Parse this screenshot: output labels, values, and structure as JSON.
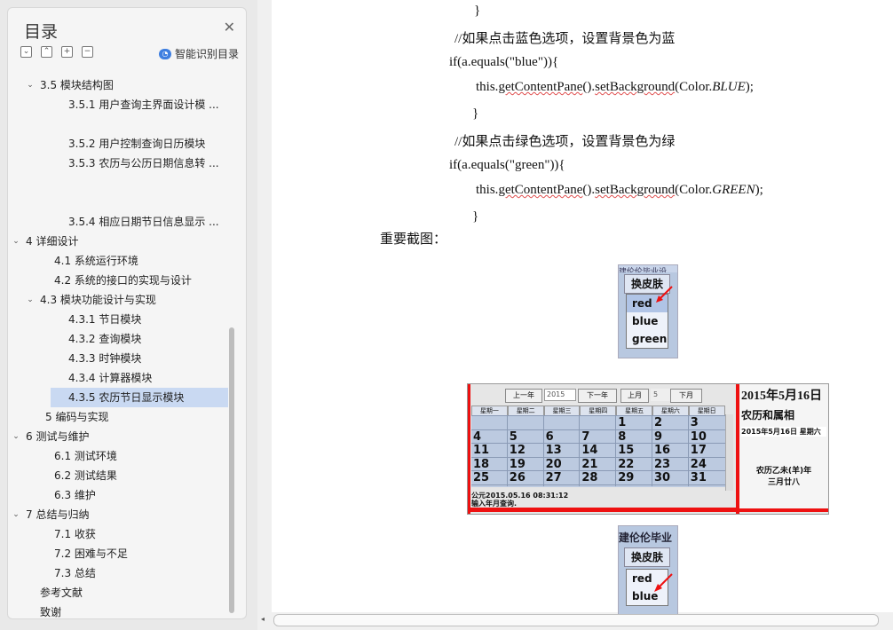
{
  "nav": {
    "title": "目录",
    "smart_label": "智能识别目录",
    "items": [
      {
        "text": "3.5  模块结构图",
        "arrow": "⌄"
      },
      {
        "text": "3.5.1  用户查询主界面设计模 ...",
        "arrow": ""
      },
      {
        "text": "3.5.2  用户控制查询日历模块",
        "arrow": ""
      },
      {
        "text": "3.5.3 农历与公历日期信息转 ...",
        "arrow": ""
      },
      {
        "text": "3.5.4 相应日期节日信息显示 ...",
        "arrow": ""
      },
      {
        "text": "4  详细设计",
        "arrow": "⌄"
      },
      {
        "text": "4.1  系统运行环境",
        "arrow": ""
      },
      {
        "text": "4.2  系统的接口的实现与设计",
        "arrow": ""
      },
      {
        "text": "4.3 模块功能设计与实现",
        "arrow": "⌄"
      },
      {
        "text": "4.3.1  节日模块",
        "arrow": ""
      },
      {
        "text": "4.3.2  查询模块",
        "arrow": ""
      },
      {
        "text": "4.3.3  时钟模块",
        "arrow": ""
      },
      {
        "text": "4.3.4  计算器模块",
        "arrow": ""
      },
      {
        "text": "4.3.5  农历节日显示模块",
        "arrow": ""
      },
      {
        "text": "5  编码与实现",
        "arrow": ""
      },
      {
        "text": "6  测试与维护",
        "arrow": "⌄"
      },
      {
        "text": "6.1 测试环境",
        "arrow": ""
      },
      {
        "text": "6.2  测试结果",
        "arrow": ""
      },
      {
        "text": "6.3  维护",
        "arrow": ""
      },
      {
        "text": "7  总结与归纳",
        "arrow": "⌄"
      },
      {
        "text": "7.1  收获",
        "arrow": ""
      },
      {
        "text": "7.2  困难与不足",
        "arrow": ""
      },
      {
        "text": "7.3 总结",
        "arrow": ""
      },
      {
        "text": "参考文献",
        "arrow": ""
      },
      {
        "text": "致谢",
        "arrow": ""
      }
    ],
    "selected_index": 13
  },
  "doc": {
    "code_lines": [
      {
        "text": "}"
      },
      {
        "text": "//如果点击蓝色选项，设置背景色为蓝"
      },
      {
        "text": "if(a.equals(\"blue\")){"
      },
      {
        "pre": "this.",
        "wavy1": "getContentPane",
        "mid": "().",
        "wavy2": "setBackground",
        "post1": "(Color.",
        "italic": "BLUE",
        "post2": ");"
      },
      {
        "text": "}"
      },
      {
        "text": "//如果点击绿色选项，设置背景色为绿"
      },
      {
        "text": "if(a.equals(\"green\")){"
      },
      {
        "pre": "this.",
        "wavy1": "getContentPane",
        "mid": "().",
        "wavy2": "setBackground",
        "post1": "(Color.",
        "italic": "GREEN",
        "post2": ");"
      },
      {
        "text": "}"
      }
    ],
    "heading": "重要截图："
  },
  "skin_menu": {
    "cut_text": "建伦伦毕业设",
    "button": "换皮肤",
    "options": [
      "red",
      "blue",
      "green"
    ]
  },
  "calendar": {
    "buttons": {
      "prev_year": "上一年",
      "next_year": "下一年",
      "prev_month": "上月",
      "next_month": "下月"
    },
    "year_input": "2015",
    "month_input": "5",
    "weekdays": [
      "星期一",
      "星期二",
      "星期三",
      "星期四",
      "星期五",
      "星期六",
      "星期日"
    ],
    "days": [
      [
        "",
        "",
        "",
        "",
        "1",
        "2",
        "3"
      ],
      [
        "4",
        "5",
        "6",
        "7",
        "8",
        "9",
        "10"
      ],
      [
        "11",
        "12",
        "13",
        "14",
        "15",
        "16",
        "17"
      ],
      [
        "18",
        "19",
        "20",
        "21",
        "22",
        "23",
        "24"
      ],
      [
        "25",
        "26",
        "27",
        "28",
        "29",
        "30",
        "31"
      ]
    ],
    "footer1": "公元2015.05.16 08:31:12",
    "footer2": "输入年月查询.",
    "right_date": "2015年5月16日",
    "right_sub": "农历和属相",
    "right_day": "2015年5月16日  星期六",
    "right_lunar1": "农历乙未(羊)年",
    "right_lunar2": "三月廿八"
  },
  "skin_menu2": {
    "cut_text": "建伦伦毕业设",
    "button": "换皮肤",
    "options": [
      "red",
      "blue"
    ]
  }
}
